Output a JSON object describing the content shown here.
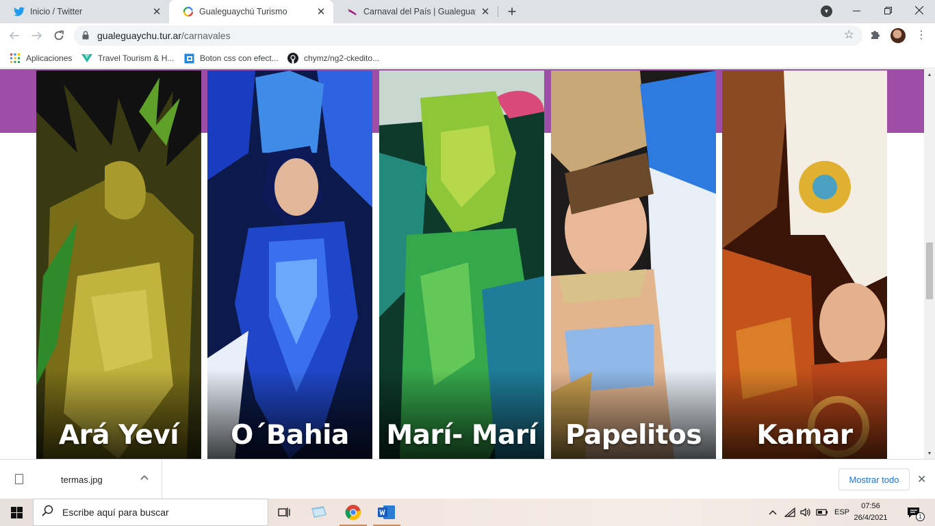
{
  "browser": {
    "tabs": [
      {
        "title": "Inicio / Twitter",
        "icon": "twitter-icon",
        "active": false
      },
      {
        "title": "Gualeguaychú Turismo",
        "icon": "google-icon",
        "active": true
      },
      {
        "title": "Carnaval del País | Gualeguaychú",
        "icon": "carnaval-logo-icon",
        "active": false
      }
    ],
    "new_tab_label": "+",
    "address": {
      "domain": "gualeguaychu.tur.ar",
      "path": "/carnavales"
    },
    "bookmarks": [
      {
        "label": "Aplicaciones",
        "icon": "apps-grid-icon"
      },
      {
        "label": "Travel Tourism & H...",
        "icon": "travel-logo-icon"
      },
      {
        "label": "Boton css con efect...",
        "icon": "codepen-icon"
      },
      {
        "label": "chymz/ng2-ckedito...",
        "icon": "github-icon"
      }
    ]
  },
  "page": {
    "band_color": "#9e4ea6",
    "comparsas": [
      {
        "name": "Ará Yeví",
        "palette": [
          "#2a2a10",
          "#8a7a1c",
          "#d6c84a"
        ]
      },
      {
        "name": "O´Bahia",
        "palette": [
          "#0b1a4a",
          "#1f46c8",
          "#5fa6ff"
        ]
      },
      {
        "name": "Marí- Marí",
        "palette": [
          "#0d3a2a",
          "#35a84c",
          "#a8e05a"
        ]
      },
      {
        "name": "Papelitos",
        "palette": [
          "#2a2420",
          "#c9a877",
          "#e8eef6"
        ]
      },
      {
        "name": "Kamar",
        "palette": [
          "#3a1406",
          "#c3521b",
          "#f4ede4"
        ]
      }
    ]
  },
  "downloads": {
    "file_name": "termas.jpg",
    "show_all_label": "Mostrar todo"
  },
  "taskbar": {
    "search_placeholder": "Escribe aquí para buscar",
    "language": "ESP",
    "time": "07:56",
    "date": "26/4/2021",
    "notification_count": "1"
  }
}
